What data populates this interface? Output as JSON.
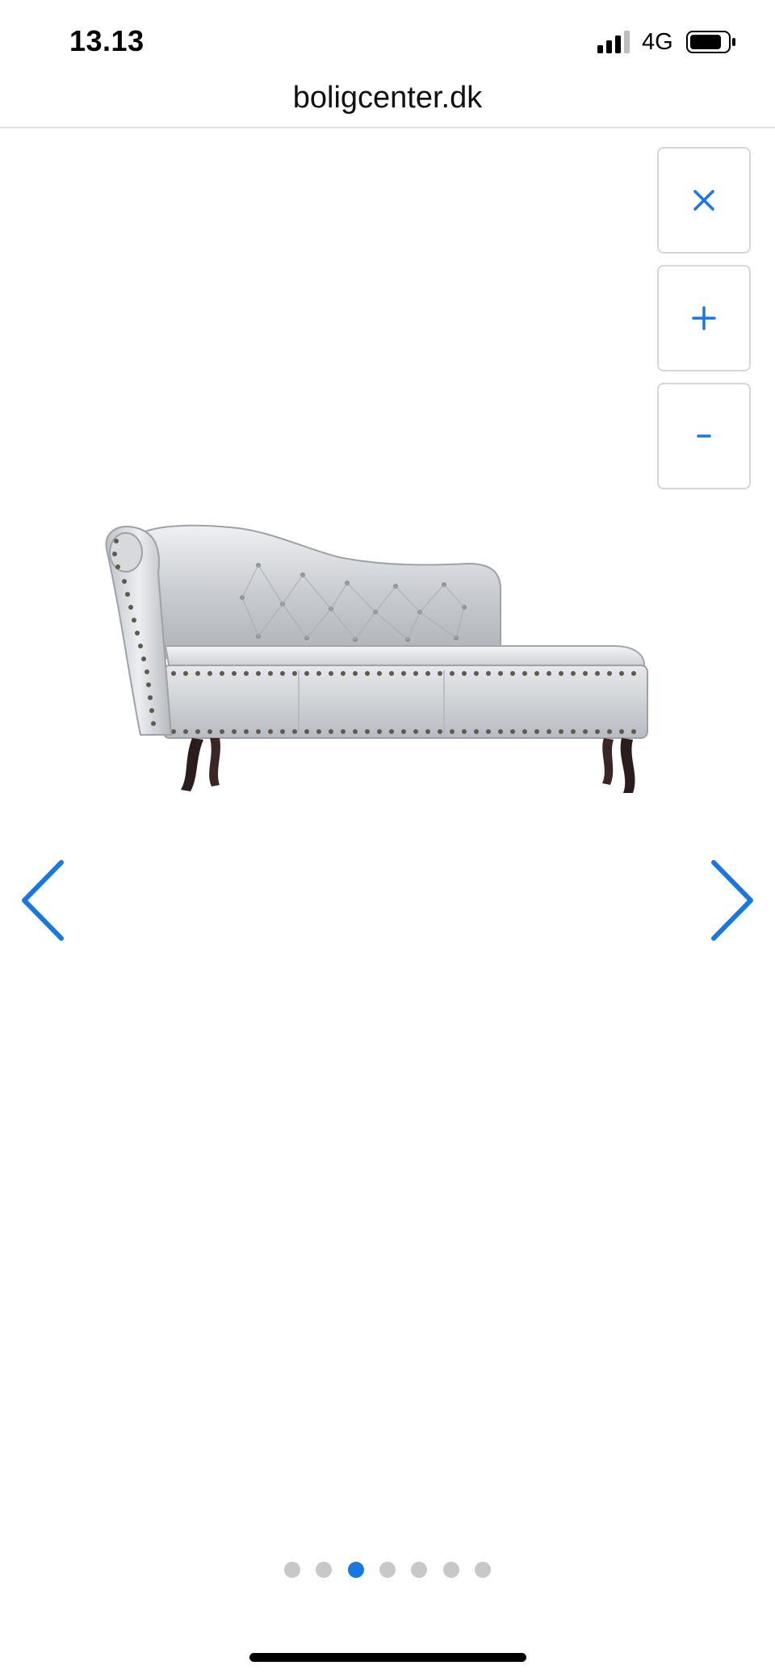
{
  "status_bar": {
    "time": "13.13",
    "network": "4G",
    "icons": [
      "signal-icon",
      "battery-icon"
    ]
  },
  "browser": {
    "url": "boligcenter.dk"
  },
  "zoom_controls": {
    "close_icon": "close-icon",
    "zoom_in_icon": "plus-icon",
    "zoom_out_icon": "minus-icon"
  },
  "gallery": {
    "image_subject": "silver chaise longue",
    "prev_icon": "chevron-left-icon",
    "next_icon": "chevron-right-icon",
    "total_images": 7,
    "active_index": 3
  },
  "colors": {
    "accent": "#1877e0",
    "dot_inactive": "#c8c8c8",
    "divider": "#e3e3e3"
  }
}
